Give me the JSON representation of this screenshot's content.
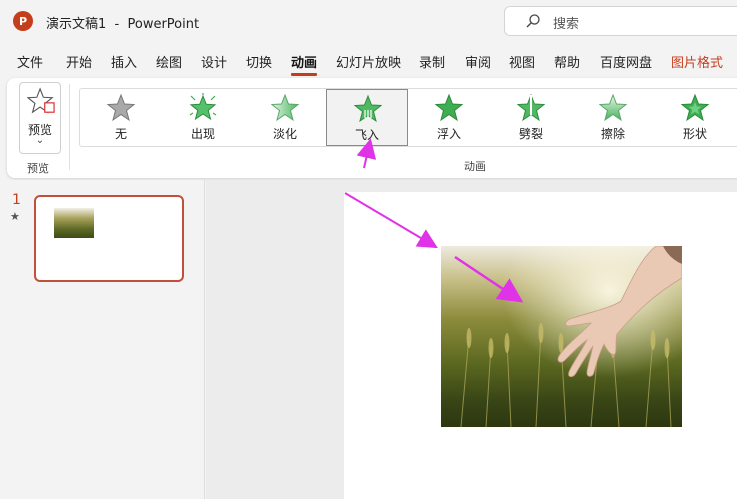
{
  "app": {
    "logo_letter": "P",
    "doc_title": "演示文稿1  -  PowerPoint"
  },
  "search": {
    "label": "搜索"
  },
  "menu": {
    "tabs": [
      {
        "label": "文件"
      },
      {
        "label": "开始"
      },
      {
        "label": "插入"
      },
      {
        "label": "绘图"
      },
      {
        "label": "设计"
      },
      {
        "label": "切换"
      },
      {
        "label": "动画",
        "active": true
      },
      {
        "label": "幻灯片放映"
      },
      {
        "label": "录制"
      },
      {
        "label": "审阅"
      },
      {
        "label": "视图"
      },
      {
        "label": "帮助"
      },
      {
        "label": "百度网盘"
      },
      {
        "label": "图片格式",
        "contextual": true
      }
    ]
  },
  "ribbon": {
    "preview": {
      "label": "预览",
      "group_label": "预览"
    },
    "animations": {
      "group_label": "动画",
      "items": [
        {
          "label": "无",
          "icon": "star-gray-icon"
        },
        {
          "label": "出现",
          "icon": "star-burst-icon"
        },
        {
          "label": "淡化",
          "icon": "star-fade-icon"
        },
        {
          "label": "飞入",
          "icon": "star-fly-in-icon",
          "selected": true
        },
        {
          "label": "浮入",
          "icon": "star-green-icon"
        },
        {
          "label": "劈裂",
          "icon": "star-split-icon"
        },
        {
          "label": "擦除",
          "icon": "star-wipe-icon"
        },
        {
          "label": "形状",
          "icon": "star-shape-icon"
        }
      ]
    }
  },
  "slides": {
    "items": [
      {
        "number": "1",
        "has_animation_marker": "★"
      }
    ]
  },
  "colors": {
    "accent": "#c43e1c",
    "annotation_arrow": "#e033e8",
    "star_green": "#3fae52"
  }
}
